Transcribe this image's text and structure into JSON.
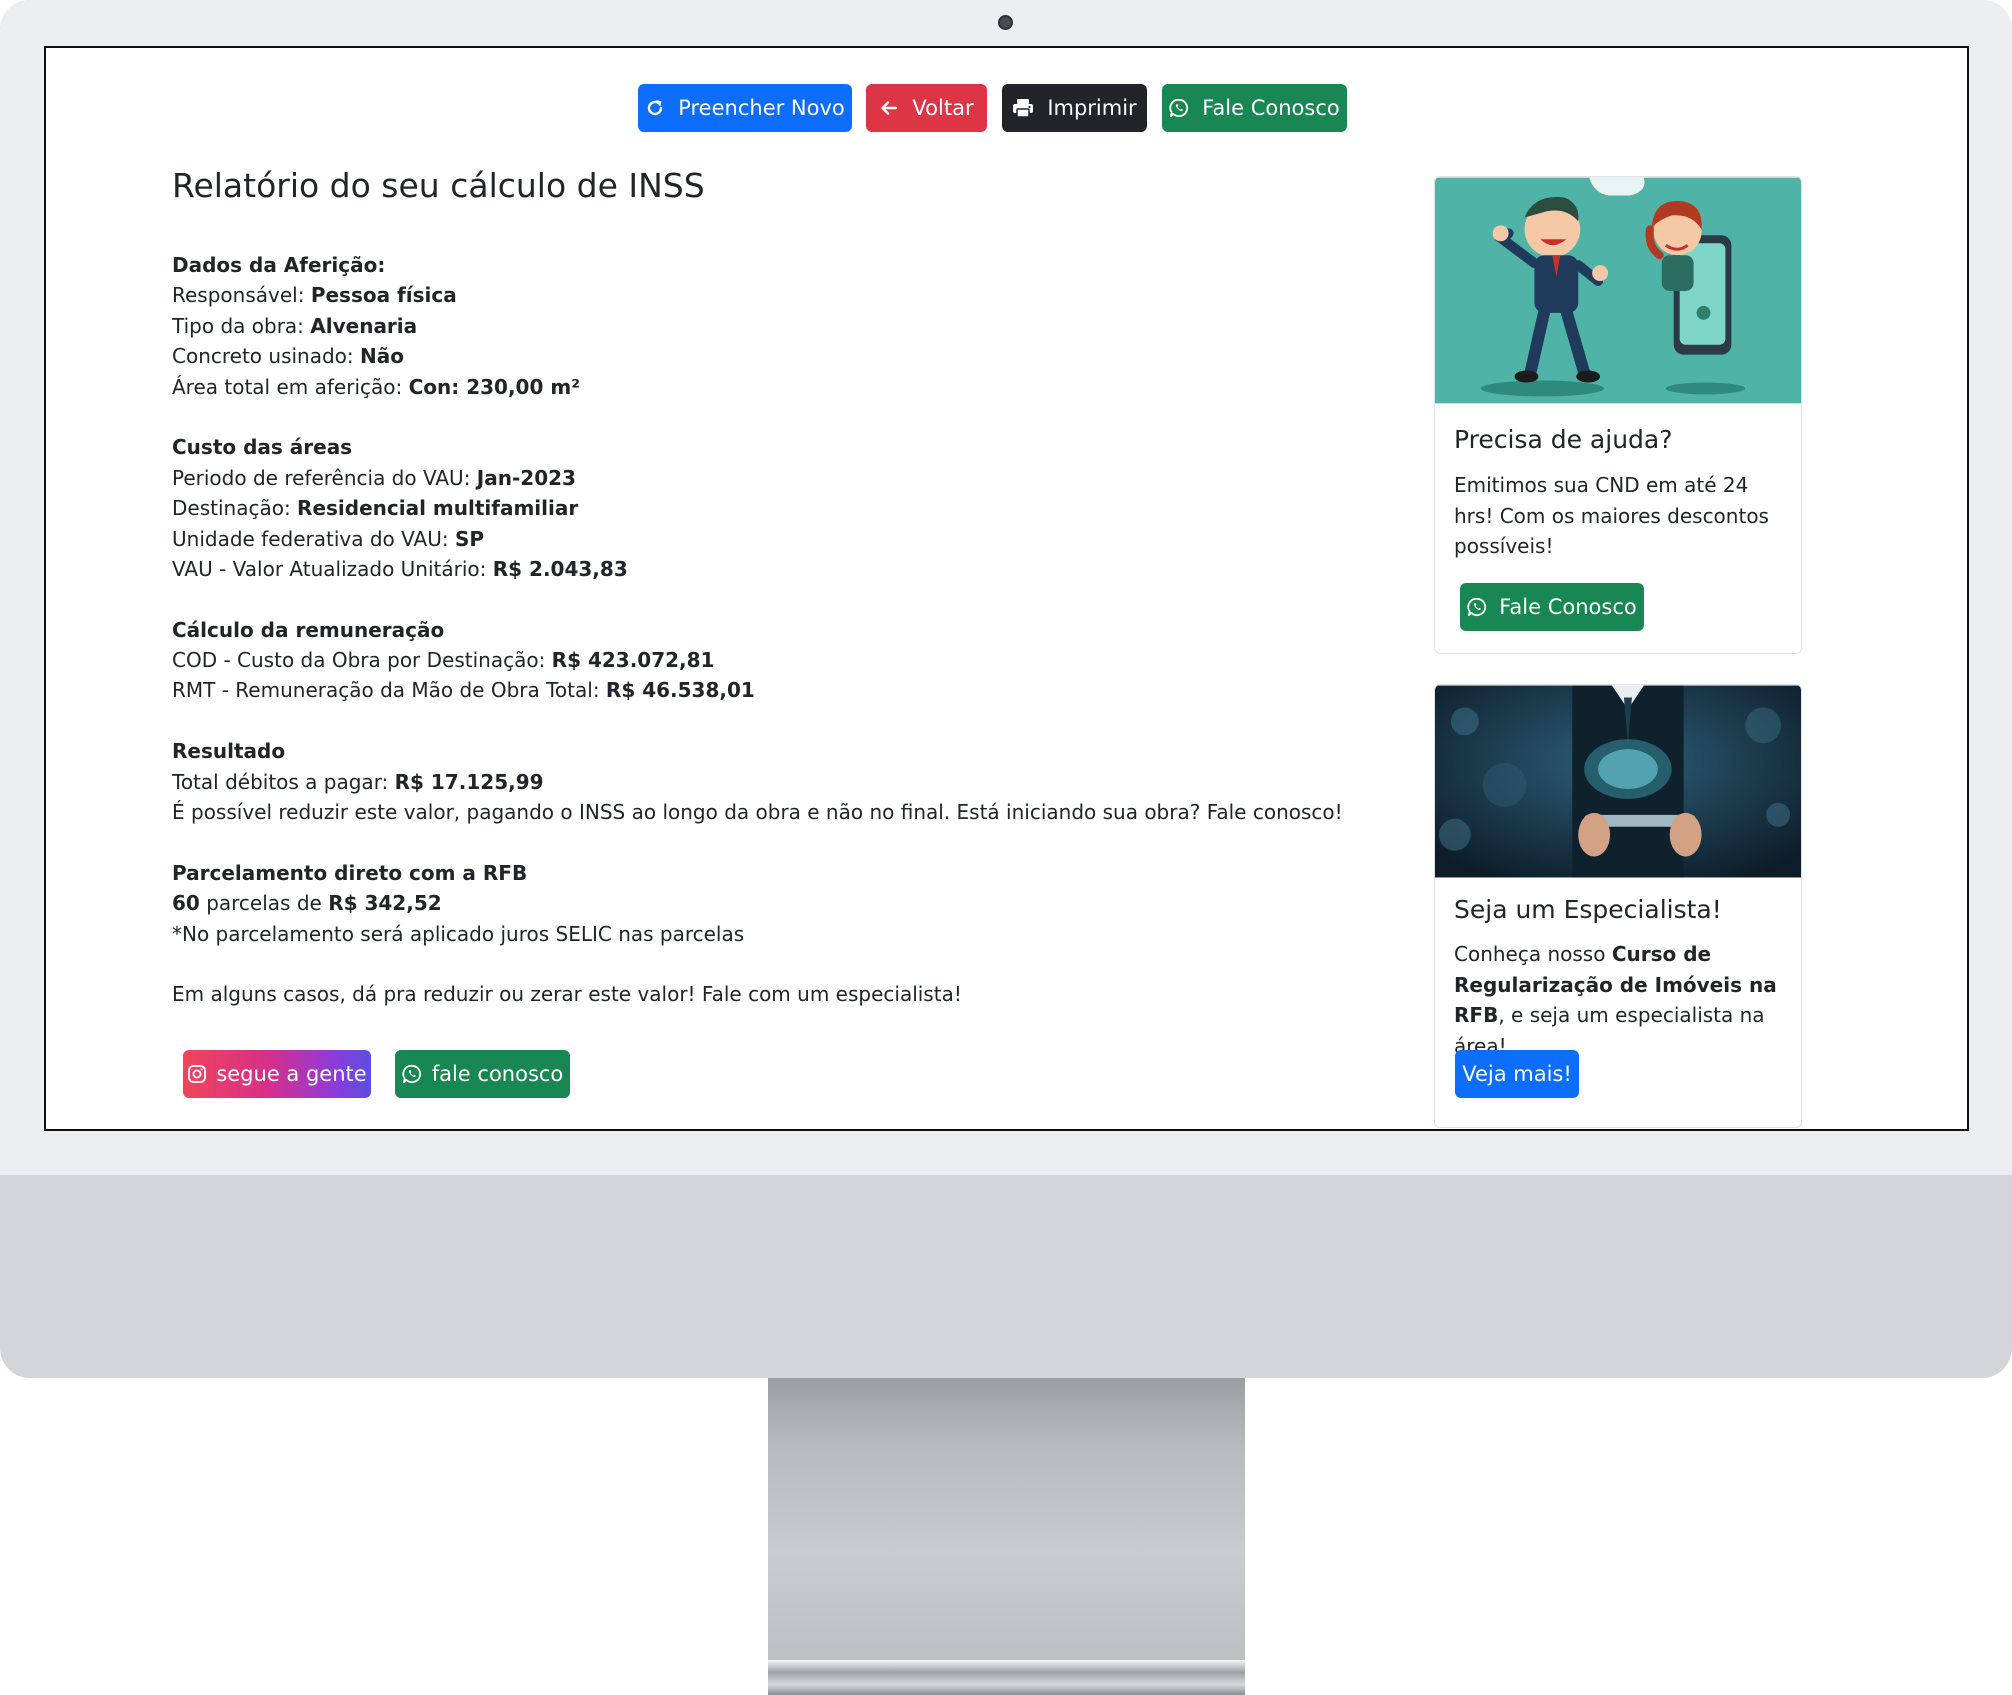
{
  "toolbar": {
    "refill_label": "Preencher Novo",
    "back_label": "Voltar",
    "print_label": "Imprimir",
    "contact_label": "Fale Conosco"
  },
  "report": {
    "title": "Relatório do seu cálculo de INSS",
    "afericao": {
      "heading": "Dados da Aferição:",
      "responsavel_label": "Responsável: ",
      "responsavel_value": "Pessoa física",
      "tipo_obra_label": "Tipo da obra: ",
      "tipo_obra_value": "Alvenaria",
      "concreto_label": "Concreto usinado: ",
      "concreto_value": "Não",
      "area_label": "Área total em aferição: ",
      "area_value": "Con: 230,00 m²"
    },
    "custo": {
      "heading": "Custo das áreas",
      "periodo_label": "Periodo de referência do VAU: ",
      "periodo_value": "Jan-2023",
      "destinacao_label": "Destinação: ",
      "destinacao_value": "Residencial multifamiliar",
      "uf_label": "Unidade federativa do VAU: ",
      "uf_value": "SP",
      "vau_label": "VAU - Valor Atualizado Unitário: ",
      "vau_value": "R$ 2.043,83"
    },
    "remuneracao": {
      "heading": "Cálculo da remuneração",
      "cod_label": "COD - Custo da Obra por Destinação: ",
      "cod_value": "R$ 423.072,81",
      "rmt_label": "RMT - Remuneração da Mão de Obra Total: ",
      "rmt_value": "R$ 46.538,01"
    },
    "resultado": {
      "heading": "Resultado",
      "total_label": "Total débitos a pagar: ",
      "total_value": "R$ 17.125,99",
      "note": "É possível reduzir este valor, pagando o INSS ao longo da obra e não no final. Está iniciando sua obra? Fale conosco!"
    },
    "parcelamento": {
      "heading": "Parcelamento direto com a RFB",
      "parcelas_count": "60",
      "parcelas_text": " parcelas de ",
      "parcelas_value": "R$ 342,52",
      "selic_note": "*No parcelamento será aplicado juros SELIC nas parcelas"
    },
    "closing": "Em alguns casos, dá pra reduzir ou zerar este valor! Fale com um especialista!"
  },
  "footer_buttons": {
    "instagram_label": "segue a gente",
    "whatsapp_label": "fale conosco"
  },
  "help_card": {
    "title": "Precisa de ajuda?",
    "text": "Emitimos sua CND em até 24 hrs! Com os maiores descontos possíveis!",
    "button_label": "Fale Conosco"
  },
  "expert_card": {
    "title": "Seja um Especialista!",
    "text_prefix": "Conheça nosso ",
    "text_bold": "Curso de Regularização de Imóveis na RFB",
    "text_suffix": ", e seja um especialista na área!",
    "button_label": "Veja mais!"
  },
  "colors": {
    "primary": "#0d6efd",
    "danger": "#dc3545",
    "dark": "#212529",
    "success": "#198754",
    "illustration_bg": "#4fb3a7",
    "monitor_bezel": "#eceef0",
    "monitor_chin": "#d3d5d8"
  },
  "icons": {
    "refill": "rotate-right-icon",
    "back": "arrow-left-icon",
    "print": "printer-icon",
    "contact": "whatsapp-icon",
    "instagram": "instagram-icon"
  }
}
